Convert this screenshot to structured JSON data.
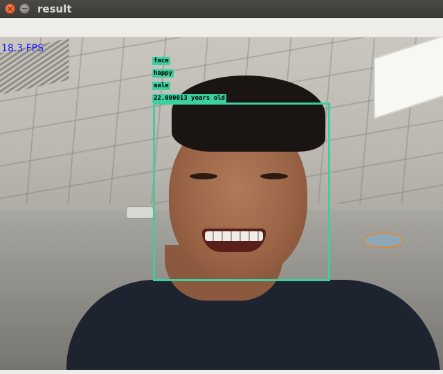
{
  "window": {
    "title": "result",
    "close_glyph": "×",
    "minimize_glyph": "−"
  },
  "overlay": {
    "fps": "18.3 FPS",
    "accent_color": "#3ccfa0",
    "fps_color": "#1c1cff",
    "labels": [
      "face",
      "happy",
      "male",
      "22.000013 years old"
    ]
  },
  "icons": {
    "close": "close-icon",
    "minimize": "minimize-icon"
  }
}
